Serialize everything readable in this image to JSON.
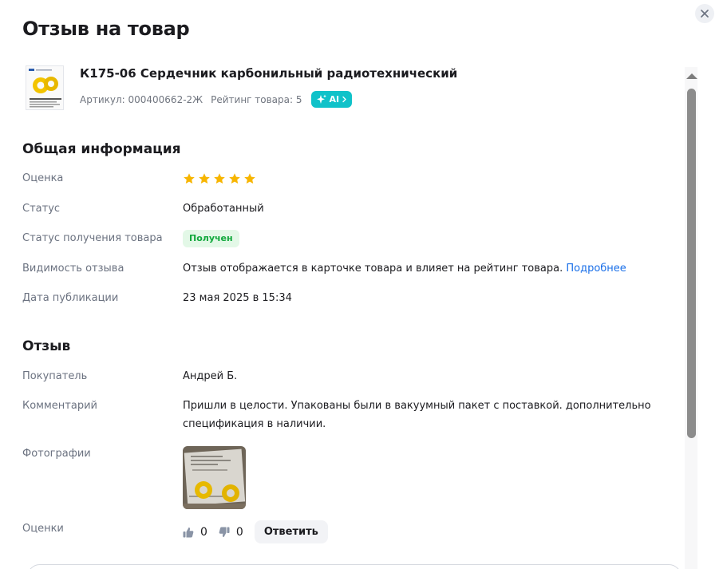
{
  "dialog": {
    "title": "Отзыв на товар",
    "close_icon": "close-icon"
  },
  "product": {
    "name": "К175-06 Сердечник карбонильный радиотехнический",
    "article": "Артикул: 000400662-2Ж",
    "rating": "Рейтинг товара: 5",
    "ai_label": "AI"
  },
  "general": {
    "title": "Общая информация",
    "rating_label": "Оценка",
    "rating_value": 5,
    "rating_max": 5,
    "status_label": "Статус",
    "status_value": "Обработанный",
    "receipt_label": "Статус получения товара",
    "receipt_value": "Получен",
    "visibility_label": "Видимость отзыва",
    "visibility_value": "Отзыв отображается в карточке товара и влияет на рейтинг товара.",
    "visibility_link": "Подробнее",
    "date_label": "Дата публикации",
    "date_value": "23 мая 2025 в 15:34"
  },
  "review": {
    "title": "Отзыв",
    "buyer_label": "Покупатель",
    "buyer_value": "Андрей Б.",
    "comment_label": "Комментарий",
    "comment_line1": "Пришли в целости. Упакованы были в вакуумный пакет с поставкой. дополнительно",
    "comment_line2": "спецификация в наличии.",
    "photos_label": "Фотографии",
    "votes_label": "Оценки",
    "likes": "0",
    "dislikes": "0",
    "reply_label": "Ответить"
  },
  "colors": {
    "star": "#f7b500",
    "accent_link": "#1a6fe8",
    "ai_badge": "#10c2c9",
    "status_green": "#11a83c"
  }
}
